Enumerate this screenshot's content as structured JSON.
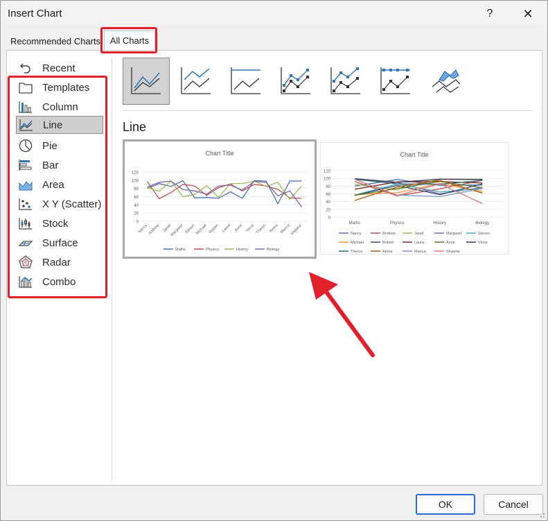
{
  "window": {
    "title": "Insert Chart",
    "help_label": "?",
    "close_label": "✕"
  },
  "tabs": [
    {
      "label": "Recommended Charts",
      "active": false
    },
    {
      "label": "All Charts",
      "active": true
    }
  ],
  "sidebar": {
    "items": [
      {
        "label": "Recent",
        "icon": "recent-icon",
        "selected": false
      },
      {
        "label": "Templates",
        "icon": "templates-icon",
        "selected": false
      },
      {
        "label": "Column",
        "icon": "column-chart-icon",
        "selected": false
      },
      {
        "label": "Line",
        "icon": "line-chart-icon",
        "selected": true
      },
      {
        "label": "Pie",
        "icon": "pie-chart-icon",
        "selected": false
      },
      {
        "label": "Bar",
        "icon": "bar-chart-icon",
        "selected": false
      },
      {
        "label": "Area",
        "icon": "area-chart-icon",
        "selected": false
      },
      {
        "label": "X Y (Scatter)",
        "icon": "scatter-chart-icon",
        "selected": false
      },
      {
        "label": "Stock",
        "icon": "stock-chart-icon",
        "selected": false
      },
      {
        "label": "Surface",
        "icon": "surface-chart-icon",
        "selected": false
      },
      {
        "label": "Radar",
        "icon": "radar-chart-icon",
        "selected": false
      },
      {
        "label": "Combo",
        "icon": "combo-chart-icon",
        "selected": false
      }
    ]
  },
  "subtypes": [
    {
      "icon": "line-icon",
      "selected": true
    },
    {
      "icon": "stacked-line-icon",
      "selected": false
    },
    {
      "icon": "100-stacked-line-icon",
      "selected": false
    },
    {
      "icon": "line-with-markers-icon",
      "selected": false
    },
    {
      "icon": "stacked-line-with-markers-icon",
      "selected": false
    },
    {
      "icon": "100-stacked-line-with-markers-icon",
      "selected": false
    },
    {
      "icon": "3d-line-icon",
      "selected": false
    }
  ],
  "section": {
    "title": "Line"
  },
  "previews": [
    {
      "selected": true,
      "chart_data": {
        "type": "line",
        "title": "Chart Title",
        "ylim": [
          0,
          120
        ],
        "yticks": [
          "120",
          "100",
          "80",
          "60",
          "40",
          "20",
          "0"
        ],
        "categories": [
          "Nancy",
          "Andrew",
          "Janet",
          "Margaret",
          "Steven",
          "Michael",
          "Robert",
          "Laura",
          "Anne",
          "Vince",
          "Theron",
          "Amira",
          "Marica",
          "Shawne"
        ],
        "series": [
          {
            "name": "Maths",
            "color": "#4a72b0",
            "values": [
              80,
              92,
              85,
              99,
              57,
              58,
              56,
              72,
              56,
              99,
              98,
              43,
              98,
              98
            ]
          },
          {
            "name": "Physics",
            "color": "#c0504d",
            "values": [
              97,
              55,
              70,
              90,
              86,
              63,
              82,
              91,
              74,
              90,
              86,
              78,
              57,
              56
            ]
          },
          {
            "name": "History",
            "color": "#9bbb59",
            "values": [
              82,
              73,
              98,
              60,
              65,
              87,
              58,
              92,
              92,
              98,
              85,
              95,
              53,
              86
            ]
          },
          {
            "name": "Biology",
            "color": "#8064a2",
            "values": [
              83,
              95,
              98,
              77,
              74,
              66,
              86,
              88,
              76,
              97,
              95,
              62,
              74,
              35
            ]
          }
        ]
      }
    },
    {
      "selected": false,
      "chart_data": {
        "type": "line",
        "title": "Chart Title",
        "ylim": [
          0,
          120
        ],
        "yticks": [
          "120",
          "100",
          "80",
          "60",
          "40",
          "20",
          "0"
        ],
        "categories": [
          "Maths",
          "Physics",
          "History",
          "Biology"
        ],
        "series": [
          {
            "name": "Nancy",
            "color": "#4a72b0",
            "values": [
              80,
              97,
              82,
              83
            ]
          },
          {
            "name": "Andrew",
            "color": "#c0504d",
            "values": [
              92,
              55,
              73,
              95
            ]
          },
          {
            "name": "Janet",
            "color": "#9bbb59",
            "values": [
              85,
              70,
              98,
              98
            ]
          },
          {
            "name": "Margaret",
            "color": "#8064a2",
            "values": [
              99,
              90,
              60,
              77
            ]
          },
          {
            "name": "Steven",
            "color": "#4bacc6",
            "values": [
              57,
              86,
              65,
              74
            ]
          },
          {
            "name": "Michael",
            "color": "#f79646",
            "values": [
              58,
              63,
              87,
              66
            ]
          },
          {
            "name": "Robert",
            "color": "#2c4d75",
            "values": [
              56,
              82,
              58,
              86
            ]
          },
          {
            "name": "Laura",
            "color": "#772c2a",
            "values": [
              72,
              91,
              92,
              88
            ]
          },
          {
            "name": "Anne",
            "color": "#5f7530",
            "values": [
              56,
              74,
              92,
              76
            ]
          },
          {
            "name": "Vince",
            "color": "#403151",
            "values": [
              99,
              90,
              98,
              97
            ]
          },
          {
            "name": "Theron",
            "color": "#276a7c",
            "values": [
              98,
              86,
              85,
              95
            ]
          },
          {
            "name": "Amira",
            "color": "#b65708",
            "values": [
              43,
              78,
              95,
              62
            ]
          },
          {
            "name": "Marica",
            "color": "#729aca",
            "values": [
              98,
              57,
              53,
              74
            ]
          },
          {
            "name": "Shawne",
            "color": "#d9777a",
            "values": [
              98,
              56,
              86,
              35
            ]
          }
        ]
      }
    }
  ],
  "buttons": {
    "ok": "OK",
    "cancel": "Cancel"
  }
}
